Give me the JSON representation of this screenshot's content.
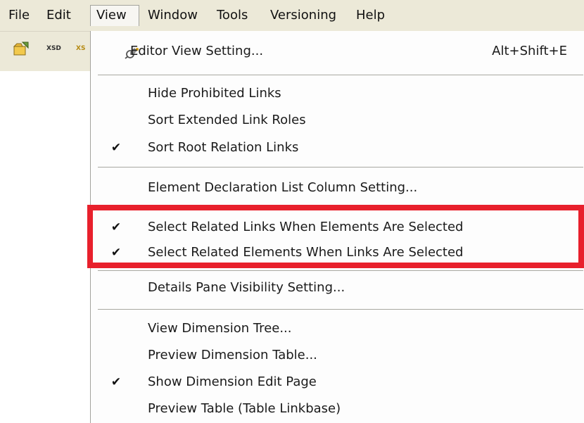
{
  "menubar": {
    "items": [
      {
        "label": "File"
      },
      {
        "label": "Edit"
      },
      {
        "label": "View"
      },
      {
        "label": "Window"
      },
      {
        "label": "Tools"
      },
      {
        "label": "Versioning"
      },
      {
        "label": "Help"
      }
    ]
  },
  "toolbar": {
    "icons": [
      "open-file-icon",
      "xsd-icon",
      "xs-icon"
    ],
    "xsd_label": "XSD",
    "xs_label": "XS"
  },
  "view_menu": {
    "editor_view_setting": {
      "label": "Editor View Setting...",
      "shortcut": "Alt+Shift+E",
      "icon": "editor-settings-icon"
    },
    "hide_prohibited_links": {
      "label": "Hide Prohibited Links",
      "checked": false
    },
    "sort_extended_link_roles": {
      "label": "Sort Extended Link Roles",
      "checked": false
    },
    "sort_root_relation_links": {
      "label": "Sort Root Relation Links",
      "checked": true
    },
    "element_declaration_list": {
      "label": "Element Declaration List Column Setting..."
    },
    "select_related_links": {
      "label": "Select Related Links When Elements Are Selected",
      "checked": true
    },
    "select_related_elements": {
      "label": "Select Related Elements When Links Are Selected",
      "checked": true
    },
    "details_pane_visibility": {
      "label": "Details Pane Visibility Setting..."
    },
    "view_dimension_tree": {
      "label": "View Dimension Tree..."
    },
    "preview_dimension_table": {
      "label": "Preview Dimension Table..."
    },
    "show_dimension_edit_page": {
      "label": "Show Dimension Edit Page",
      "checked": true
    },
    "preview_table_linkbase": {
      "label": "Preview Table (Table Linkbase)"
    }
  },
  "checkmark_glyph": "✔",
  "colors": {
    "highlight": "#e8202c",
    "menubar_bg": "#ece9d8",
    "menu_bg": "#fdfdfd"
  }
}
